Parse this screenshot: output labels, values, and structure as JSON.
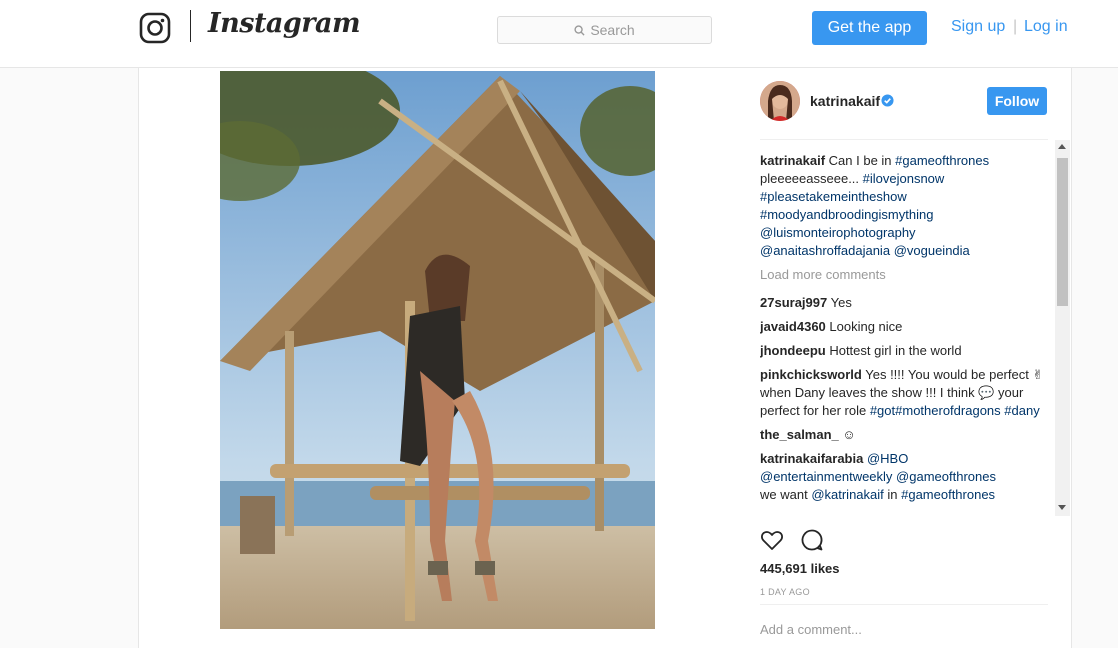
{
  "header": {
    "brand": "Instagram",
    "search_placeholder": "Search",
    "get_app": "Get the app",
    "sign_up": "Sign up",
    "separator": "|",
    "log_in": "Log in"
  },
  "post": {
    "username": "katrinakaif",
    "follow": "Follow",
    "caption_user": "katrinakaif",
    "caption_text": " Can I be in ",
    "caption_tag1": "#gameofthrones",
    "caption_text2": " pleeeeeasseee... ",
    "caption_tag2": "#ilovejonsnow",
    "caption_tag3": "#pleasetakemeintheshow",
    "caption_tag4": "#moodyandbroodingismything",
    "caption_tag5": "@luismonteirophotography",
    "caption_tag6": "@anaitashroffadajania",
    "caption_tag7": "@vogueindia",
    "load_more": "Load more comments",
    "likes": "445,691 likes",
    "time_ago": "1 DAY AGO",
    "add_comment": "Add a comment..."
  },
  "comments": [
    {
      "user": "27suraj997",
      "text": " Yes"
    },
    {
      "user": "javaid4360",
      "text": " Looking nice"
    },
    {
      "user": "jhondeepu",
      "text": " Hottest girl in the world"
    },
    {
      "user": "the_salman_",
      "text": " ☺"
    }
  ],
  "comment_pink": {
    "user": "pinkchicksworld",
    "text1": " Yes !!!! You would be perfect ✌ when Dany leaves the show !!! I think 💬 your perfect for her role ",
    "tag1": "#got",
    "tag2": "#motherofdragons",
    "tag3": " #dany"
  },
  "comment_arabia": {
    "user": "katrinakaifarabia",
    "tag1": " @HBO",
    "tag2": "@entertainmentweekly",
    "tag3": " @gameofthrones",
    "text1": "we want ",
    "tag4": "@katrinakaif",
    "text2": " in ",
    "tag5": "#gameofthrones"
  },
  "colors": {
    "accent": "#3897f0",
    "hashtag": "#003569",
    "muted": "#999999"
  }
}
